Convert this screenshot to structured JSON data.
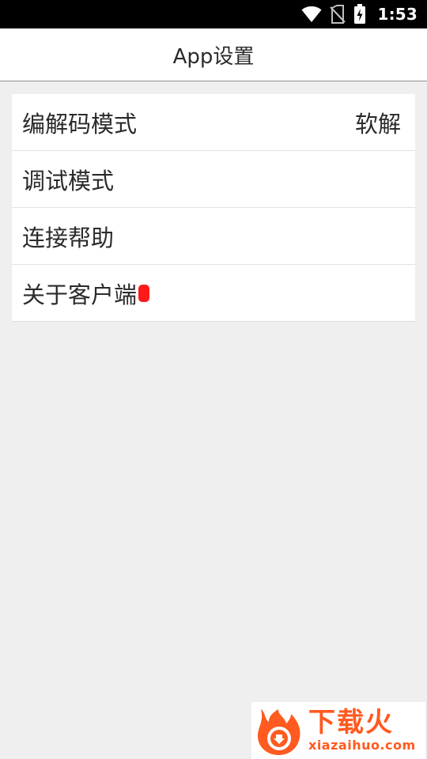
{
  "status_bar": {
    "time": "1:53",
    "icons": [
      "wifi-icon",
      "no-sim-icon",
      "battery-charging-icon"
    ]
  },
  "app_bar": {
    "title": "App设置"
  },
  "settings": [
    {
      "label": "编解码模式",
      "value": "软解"
    },
    {
      "label": "调试模式",
      "value": ""
    },
    {
      "label": "连接帮助",
      "value": ""
    },
    {
      "label": "关于客户端",
      "value": "",
      "badge": "new-indicator-dot"
    }
  ],
  "watermark": {
    "title": "下载火",
    "subtitle": "xiazaihuo.com"
  },
  "colors": {
    "status_bar_bg": "#000000",
    "app_bar_bg": "#ffffff",
    "page_bg": "#efefef",
    "text": "#2b2b2b",
    "badge": "#ff1a1a",
    "watermark_accent": "#ff5a1f"
  }
}
